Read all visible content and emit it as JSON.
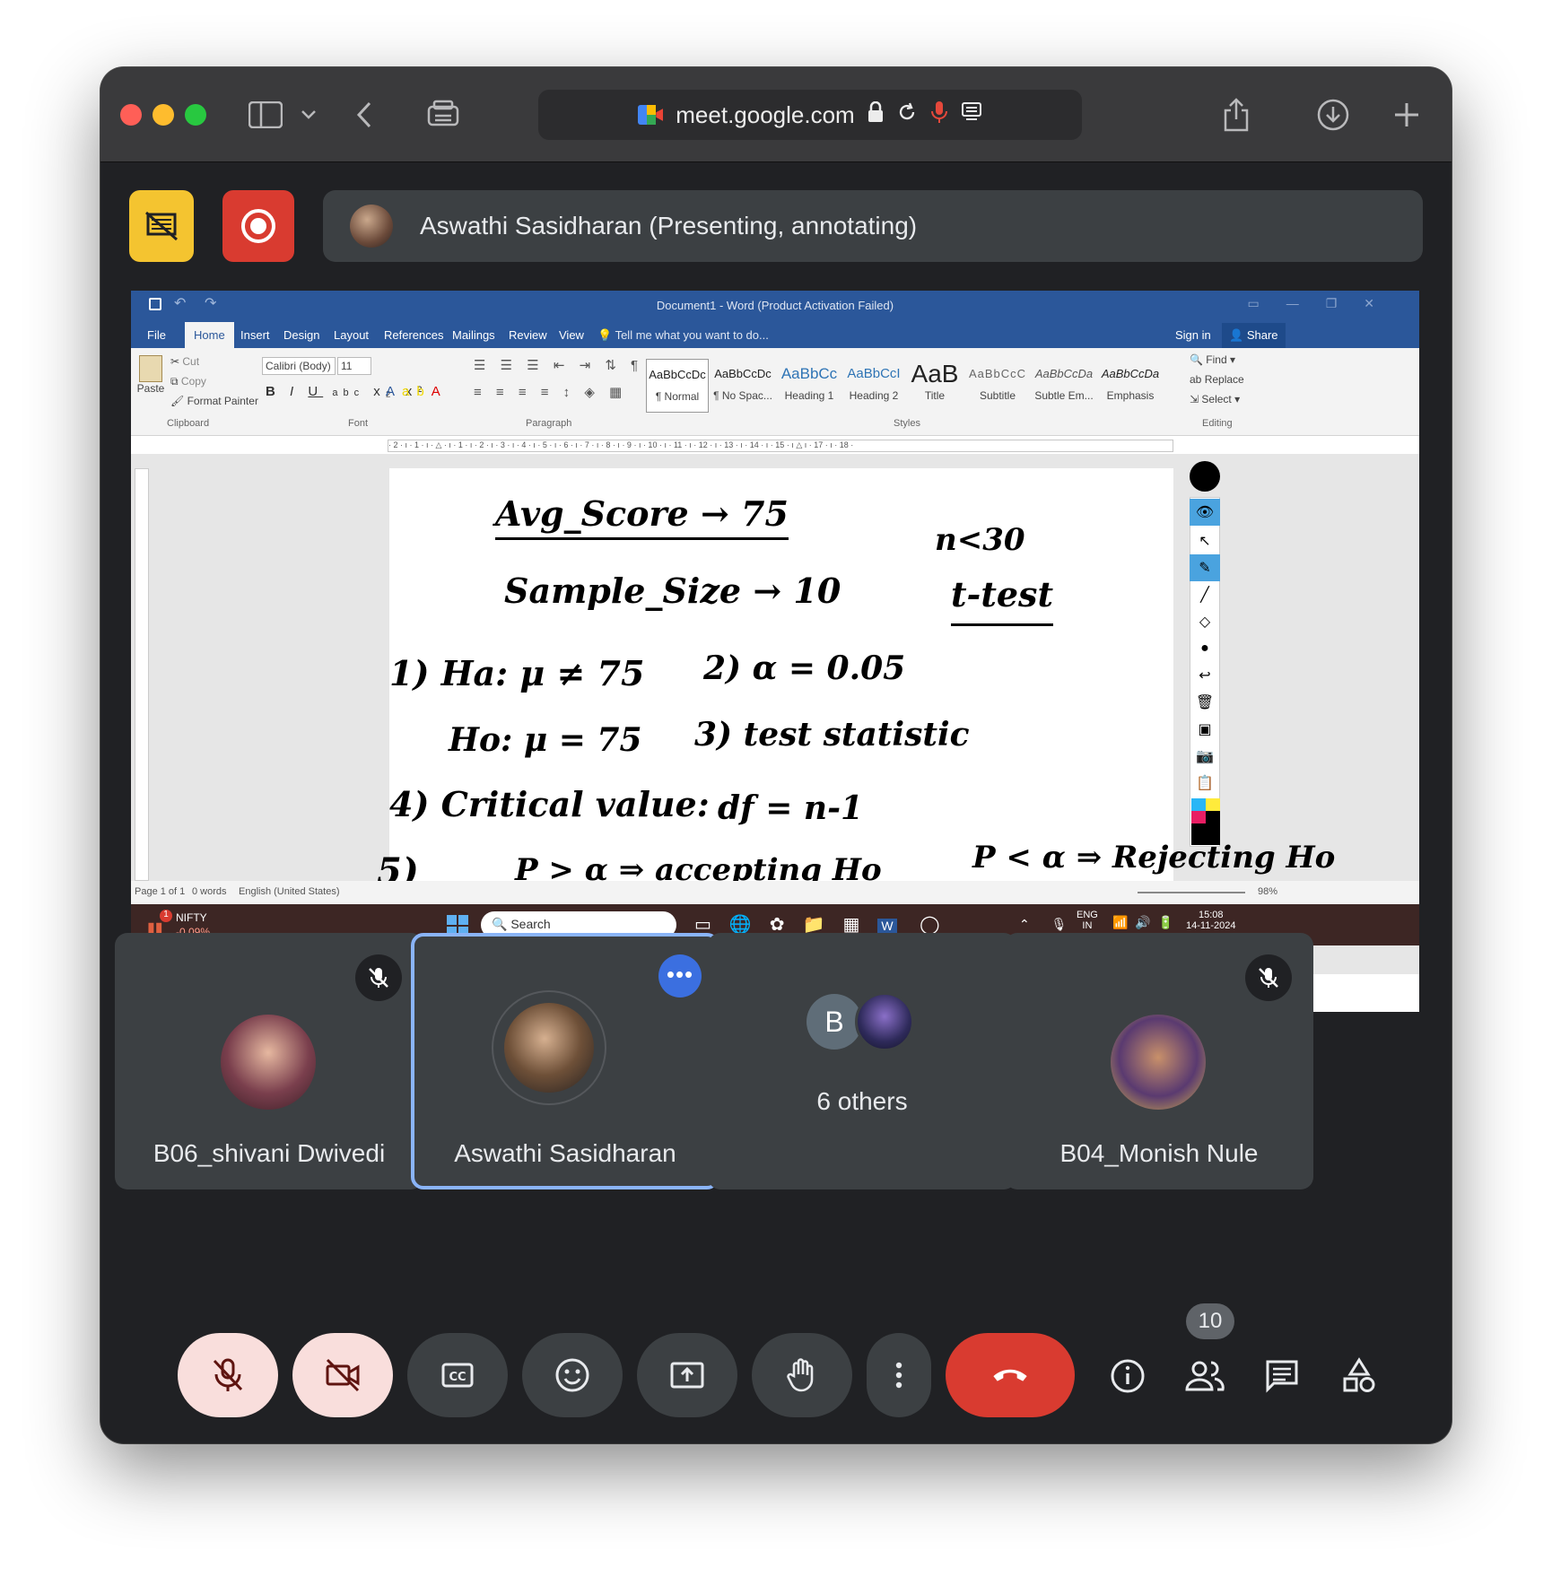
{
  "browser": {
    "url": "meet.google.com"
  },
  "meet": {
    "presenter_banner": "Aswathi Sasidharan (Presenting, annotating)",
    "participants": [
      {
        "name": "B06_shivani Dwivedi",
        "muted": true
      },
      {
        "name": "Aswathi Sasidharan",
        "muted": false,
        "active": true
      },
      {
        "name": "6 others",
        "initial": "B"
      },
      {
        "name": "B04_Monish Nule",
        "muted": true
      }
    ],
    "participant_count": "10"
  },
  "word": {
    "title": "Document1 - Word (Product Activation Failed)",
    "tabs": [
      "File",
      "Home",
      "Insert",
      "Design",
      "Layout",
      "References",
      "Mailings",
      "Review",
      "View"
    ],
    "tell_me": "Tell me what you want to do...",
    "sign_in": "Sign in",
    "share": "Share",
    "clipboard": {
      "paste": "Paste",
      "cut": "Cut",
      "copy": "Copy",
      "format_painter": "Format Painter",
      "group": "Clipboard"
    },
    "font": {
      "name": "Calibri (Body)",
      "size": "11",
      "group": "Font"
    },
    "paragraph_group": "Paragraph",
    "styles": [
      {
        "preview": "AaBbCcDc",
        "label": "¶ Normal"
      },
      {
        "preview": "AaBbCcDc",
        "label": "¶ No Spac..."
      },
      {
        "preview": "AaBbCc",
        "label": "Heading 1"
      },
      {
        "preview": "AaBbCcI",
        "label": "Heading 2"
      },
      {
        "preview": "AaB",
        "label": "Title"
      },
      {
        "preview": "AaBbCcC",
        "label": "Subtitle"
      },
      {
        "preview": "AaBbCcDa",
        "label": "Subtle Em..."
      },
      {
        "preview": "AaBbCcDa",
        "label": "Emphasis"
      }
    ],
    "styles_group": "Styles",
    "editing": {
      "find": "Find",
      "replace": "Replace",
      "select": "Select",
      "group": "Editing"
    },
    "status": {
      "page": "Page 1 of 1",
      "words": "0 words",
      "language": "English (United States)",
      "zoom": "98%"
    },
    "ruler_marks": "· 2 · ı · 1 · ı · △ · ı · 1 · ı · 2 · ı · 3 · ı · 4 · ı · 5 · ı · 6 · ı · 7 · ı · 8 · ı · 9 · ı · 10 · ı · 11 · ı · 12 · ı · 13 · ı · 14 · ı · 15 · ı △ ı · 17 · ı · 18 ·"
  },
  "annotation_lines": {
    "l1": "Avg_Score → 75",
    "l1b": "n<30",
    "l2": "Sample_Size → 10",
    "l2b": "t-test",
    "l3": "1)  Ha: μ ≠ 75",
    "l3b": "2) α = 0.05",
    "l4": "Ho: μ = 75",
    "l4b": "3) test statistic",
    "l5": "4)  Critical value:",
    "l5b": "df = n-1",
    "l6": "5)",
    "l6b": "P > α ⇒ accepting Ho",
    "l6c": "P < α ⇒ Rejecting Ho"
  },
  "taskbar": {
    "ticker": "NIFTY",
    "ticker_change": "-0.09%",
    "badge": "1",
    "search": "Search",
    "lang1": "ENG",
    "lang2": "IN",
    "time": "15:08",
    "date": "14-11-2024"
  },
  "colors": {
    "meet_bg": "#202124",
    "tile_bg": "#3c4043",
    "word_blue": "#2b579a",
    "hangup_red": "#d93b30",
    "active_tile_border": "#8ab4f8"
  }
}
